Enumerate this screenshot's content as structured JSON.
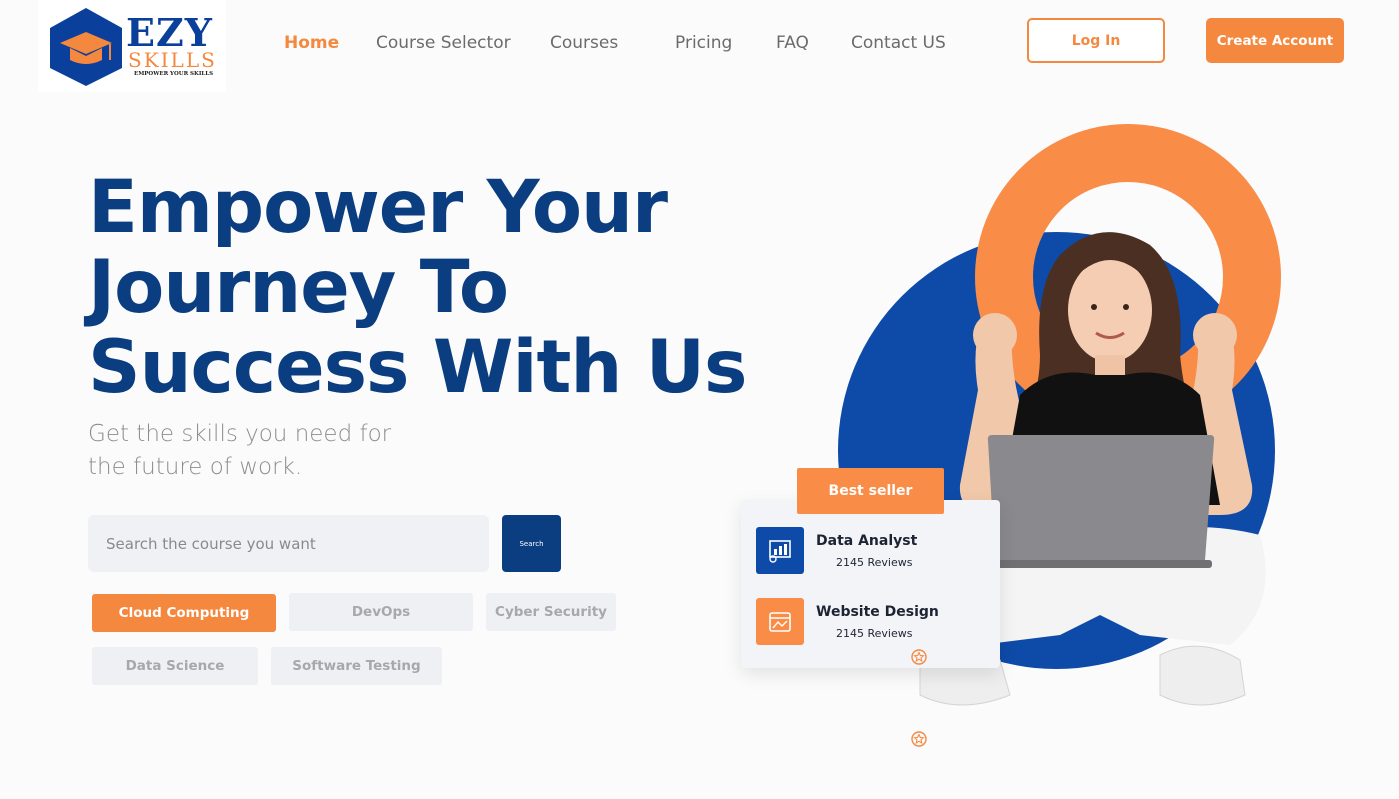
{
  "brand": {
    "name": "EZY",
    "name2": "SKILLS",
    "tagline": "EMPOWER YOUR SKILLS"
  },
  "nav": {
    "items": [
      {
        "label": "Home",
        "active": true
      },
      {
        "label": "Course Selector"
      },
      {
        "label": "Courses"
      },
      {
        "label": "Pricing"
      },
      {
        "label": "FAQ"
      },
      {
        "label": "Contact US"
      }
    ]
  },
  "auth": {
    "login_label": "Log In",
    "create_label": "Create Account"
  },
  "hero": {
    "title_line1": "Empower Your",
    "title_line2": "Journey To",
    "title_line3": "Success With Us",
    "subtitle_line1": "Get the skills you need for",
    "subtitle_line2": "the future of work."
  },
  "search": {
    "placeholder": "Search the course you want",
    "button_label": "Search"
  },
  "categories": [
    {
      "label": "Cloud Computing",
      "active": true
    },
    {
      "label": "DevOps"
    },
    {
      "label": "Cyber Security"
    },
    {
      "label": "Data Science"
    },
    {
      "label": "Software Testing"
    }
  ],
  "bestseller": {
    "badge": "Best seller",
    "courses": [
      {
        "title": "Data Analyst",
        "reviews": "2145 Reviews",
        "icon": "chart-icon"
      },
      {
        "title": "Website Design",
        "reviews": "2145 Reviews",
        "icon": "web-design-icon"
      }
    ]
  },
  "colors": {
    "primary": "#0b3e80",
    "accent": "#f5883f",
    "blue_circle": "#0e4aa8"
  }
}
